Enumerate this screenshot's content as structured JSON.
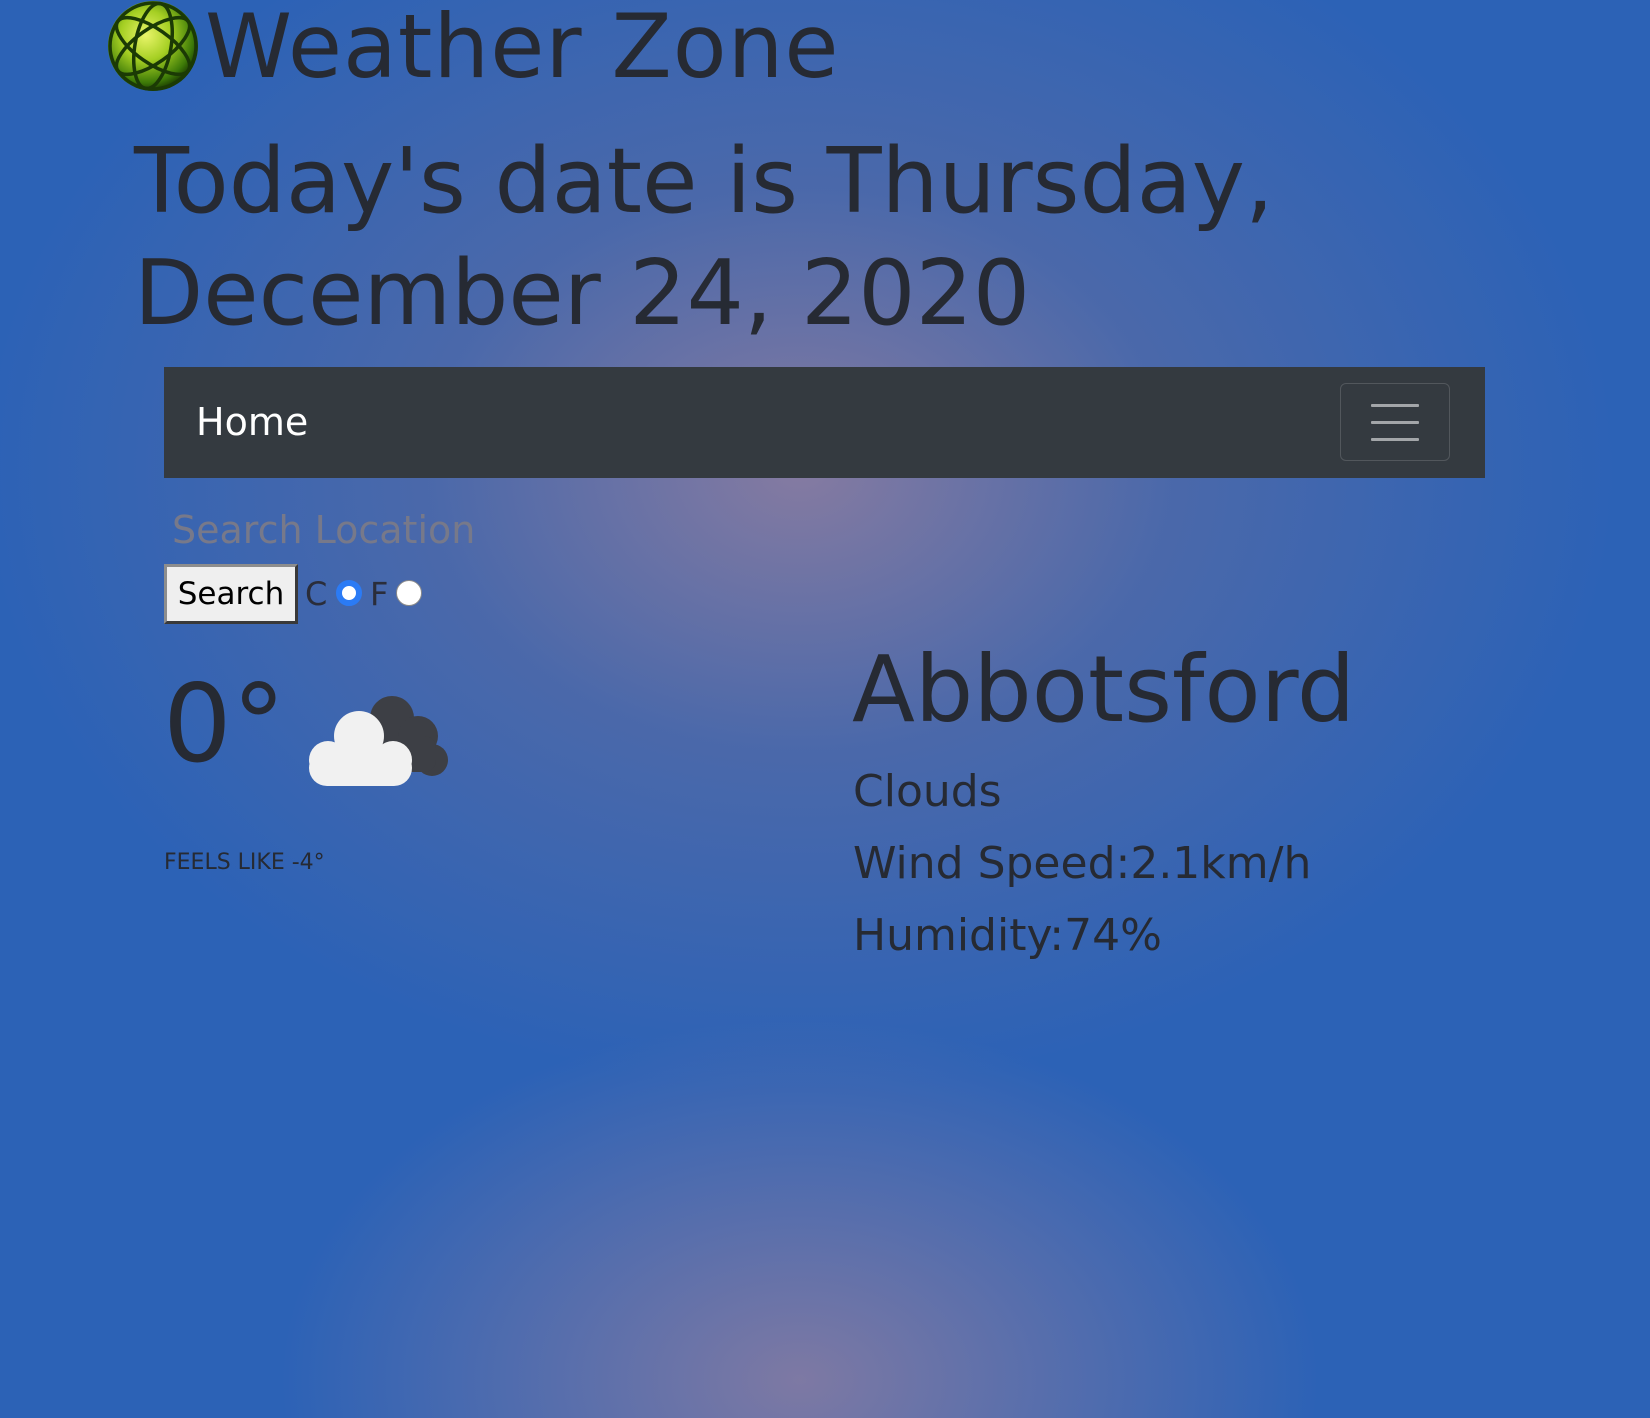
{
  "app": {
    "title": "Weather Zone",
    "logo_icon": "globe-logo-icon"
  },
  "date_heading": "Today's date is Thursday, December 24, 2020",
  "navbar": {
    "home_label": "Home",
    "toggle_icon": "hamburger-menu-icon",
    "background": "#343a40"
  },
  "search": {
    "placeholder": "Search Location",
    "value": "",
    "button_label": "Search"
  },
  "units": {
    "celsius_label": "C",
    "fahrenheit_label": "F",
    "selected": "C",
    "accent": "#2b7bf5"
  },
  "current": {
    "temperature": "0°",
    "condition_icon": "cloud-icon",
    "feels_like": "Feels like -4°"
  },
  "details": {
    "city": "Abbotsford",
    "condition": "Clouds",
    "wind_speed": "Wind Speed:2.1km/h",
    "humidity": "Humidity:74%"
  }
}
